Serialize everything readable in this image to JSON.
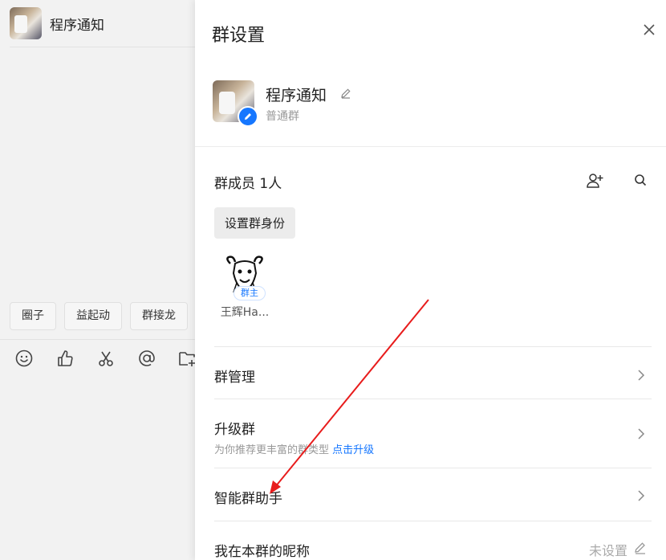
{
  "chat": {
    "title": "程序通知",
    "quick_tags": [
      "圈子",
      "益起动",
      "群接龙"
    ],
    "toolbar_icons": [
      "emoji-icon",
      "thumbs-up-icon",
      "scissors-icon",
      "at-icon",
      "folder-add-icon"
    ]
  },
  "panel": {
    "title": "群设置",
    "group": {
      "name": "程序通知",
      "type": "普通群"
    },
    "members": {
      "title": "群成员 1人",
      "role_button": "设置群身份",
      "list": [
        {
          "name": "王辉Ha...",
          "badge": "群主"
        }
      ]
    },
    "rows": {
      "manage": "群管理",
      "upgrade": {
        "title": "升级群",
        "sub": "为你推荐更丰富的群类型",
        "link": "点击升级"
      },
      "assistant": "智能群助手",
      "nickname": {
        "title": "我在本群的昵称",
        "value": "未设置"
      }
    }
  },
  "colors": {
    "accent": "#1677ff",
    "annotation_arrow": "#e81c1c"
  }
}
